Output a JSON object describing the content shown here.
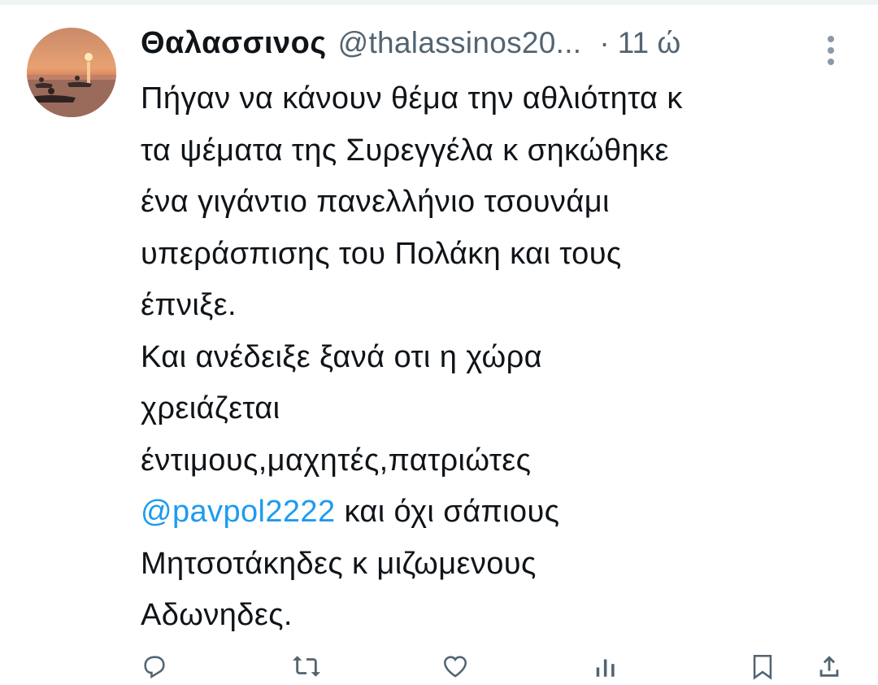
{
  "tweet": {
    "display_name": "Θαλασσινος",
    "handle": "@thalassinos20...",
    "separator": "·",
    "time": "11 ώ",
    "text": {
      "line1": "Πήγαν να κάνουν θέμα την αθλιότητα κ",
      "line2": "τα ψέματα της Συρεγγέλα κ σηκώθηκε",
      "line3": "ένα γιγάντιο πανελλήνιο τσουνάμι",
      "line4": "υπεράσπισης του Πολάκη και τους",
      "line5": "έπνιξε.",
      "line6": "Και ανέδειξε ξανά οτι η χώρα",
      "line7": "χρειάζεται",
      "line8": "έντιμους,μαχητές,πατριώτες",
      "mention": "@pavpol2222",
      "line9_rest": " και όχι σάπιους",
      "line10": "Μητσοτάκηδες κ μιζωμενους",
      "line11": "Αδωνηδες."
    }
  },
  "actions": {
    "reply_icon": "reply-icon",
    "retweet_icon": "retweet-icon",
    "like_icon": "heart-icon",
    "views_icon": "views-icon",
    "bookmark_icon": "bookmark-icon",
    "share_icon": "share-icon"
  },
  "colors": {
    "text": "#0f1419",
    "secondary": "#536471",
    "link": "#1d9bf0",
    "divider": "#eff3f4"
  }
}
